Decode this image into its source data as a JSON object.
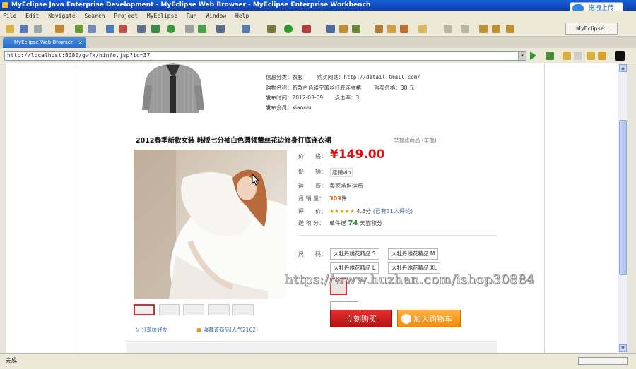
{
  "window": {
    "title": "MyEclipse Java Enterprise Development - MyEclipse Web Browser - MyEclipse Enterprise Workbench"
  },
  "overlay": {
    "upload_button": "拖拽上传"
  },
  "menu": [
    "File",
    "Edit",
    "Navigate",
    "Search",
    "Project",
    "MyEclipse",
    "Run",
    "Window",
    "Help"
  ],
  "toolbar": {
    "perspective": "MyEclipse ..."
  },
  "tab": {
    "label": "MyEclipse Web Browser",
    "close": "×"
  },
  "address": {
    "url": "http://localhost:8080/gwfx/hinfo.jsp?id=37",
    "dropdown_glyph": "▾"
  },
  "product_info": {
    "category_label": "信息分类：",
    "category_value": "衣服",
    "source_label": "购买网站：",
    "source_value": "http://detail.tmall.com/",
    "name_label": "购物名称：",
    "name_value": "新款白色镂空蕾丝打底连衣裙",
    "price_label": "购买价格：",
    "price_value": "38 元",
    "date_label": "发布时间：",
    "date_value": "2012-03-09",
    "clicks_label": "点击率：",
    "clicks_value": "3",
    "member_label": "发布会员：",
    "member_value": "xiaoniu"
  },
  "product": {
    "title": "2012春季新款女装  韩版七分袖白色圆领蕾丝花边修身打底连衣裙",
    "report": "举报此商品 (举报)",
    "price_label": "价　　格：",
    "price": "¥149.00",
    "promo_label": "促　　销：",
    "promo": "店铺vip",
    "shipping_label": "运　　费：",
    "shipping": "卖家承担运费",
    "sales_label": "月 销 量：",
    "sales_count": "303",
    "sales_unit": "件",
    "rating_label": "评　　价：",
    "rating_stars": "★★★★★",
    "rating_value": "4.8分",
    "rating_reviews": "(已有31人评论)",
    "points_label": "送 积 分：",
    "points_prefix": "单件送",
    "points_value": "74",
    "points_suffix": "天猫积分",
    "size_label": "尺　　码：",
    "sizes": [
      "大牡丹绣花精品 S",
      "大牡丹绣花精品 M",
      "大牡丹绣花精品 L",
      "大牡丹绣花精品 XL"
    ],
    "buy_now": "立刻购买",
    "add_to_cart": "加入购物车",
    "share": "分享给好友",
    "favorite": "收藏该商品(人气2162)"
  },
  "watermark": "https://www.huzhan.com/ishop30884",
  "status": {
    "text": "完成"
  },
  "colors": {
    "price_red": "#dd1111",
    "buy_red": "#c81818",
    "cart_orange": "#f39a20",
    "titlebar_blue": "#0a3fb0"
  }
}
